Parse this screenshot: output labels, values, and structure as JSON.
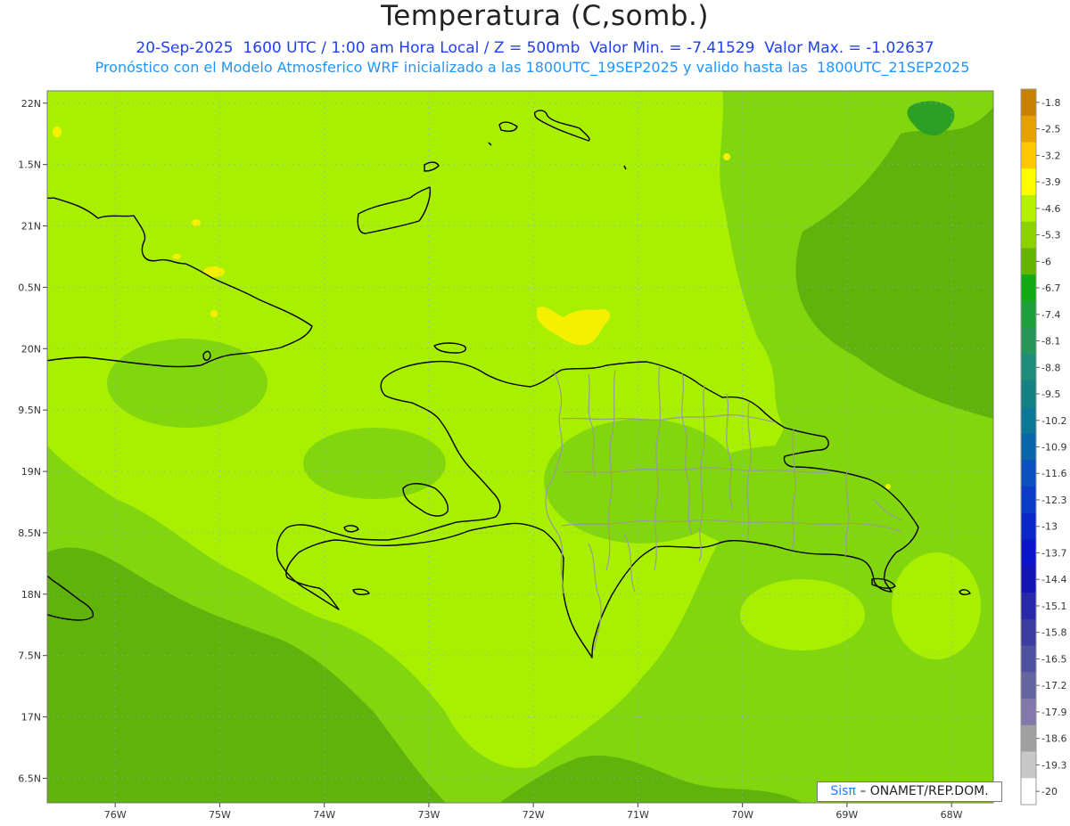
{
  "title": "Temperatura (C,somb.)",
  "subtitle_line1": "20-Sep-2025  1600 UTC / 1:00 am Hora Local / Z = 500mb  Valor Min. = -7.41529  Valor Max. = -1.02637",
  "subtitle_line2": "Pronóstico con el Modelo Atmosferico WRF inicializado a las 1800UTC_19SEP2025 y valido hasta las  1800UTC_21SEP2025",
  "credit": {
    "sis": "Sisπ",
    "org": "– ONAMET/REP.DOM."
  },
  "map": {
    "lon_range": [
      -76.65,
      -67.6
    ],
    "lat_range": [
      16.3,
      22.1
    ],
    "lat_ticks": [
      {
        "value": 22.0,
        "label": "22N"
      },
      {
        "value": 21.5,
        "label": "1.5N"
      },
      {
        "value": 21.0,
        "label": "21N"
      },
      {
        "value": 20.5,
        "label": "0.5N"
      },
      {
        "value": 20.0,
        "label": "20N"
      },
      {
        "value": 19.5,
        "label": "9.5N"
      },
      {
        "value": 19.0,
        "label": "19N"
      },
      {
        "value": 18.5,
        "label": "8.5N"
      },
      {
        "value": 18.0,
        "label": "18N"
      },
      {
        "value": 17.5,
        "label": "7.5N"
      },
      {
        "value": 17.0,
        "label": "17N"
      },
      {
        "value": 16.5,
        "label": "6.5N"
      }
    ],
    "lon_ticks": [
      {
        "value": -76,
        "label": "76W"
      },
      {
        "value": -75,
        "label": "75W"
      },
      {
        "value": -74,
        "label": "74W"
      },
      {
        "value": -73,
        "label": "73W"
      },
      {
        "value": -72,
        "label": "72W"
      },
      {
        "value": -71,
        "label": "71W"
      },
      {
        "value": -70,
        "label": "70W"
      },
      {
        "value": -69,
        "label": "69W"
      },
      {
        "value": -68,
        "label": "68W"
      }
    ],
    "colors": {
      "base": "#82d60e",
      "light": "#a8f000",
      "dark": "#5fb30b",
      "darkest": "#2ba024",
      "yellow": "#f5f000",
      "coast": "#000000",
      "provinces": "#9a9a9a",
      "grid": "#a0a0d0"
    }
  },
  "legend": {
    "labels": [
      "-1.8",
      "-2.5",
      "-3.2",
      "-3.9",
      "-4.6",
      "-5.3",
      "-6",
      "-6.7",
      "-7.4",
      "-8.1",
      "-8.8",
      "-9.5",
      "-10.2",
      "-10.9",
      "-11.6",
      "-12.3",
      "-13",
      "-13.7",
      "-14.4",
      "-15.1",
      "-15.8",
      "-16.5",
      "-17.2",
      "-17.9",
      "-18.6",
      "-19.3",
      "-20"
    ],
    "colors": [
      "#c88000",
      "#e6a000",
      "#ffc800",
      "#ffff00",
      "#b4f000",
      "#8cd200",
      "#64b400",
      "#14aa14",
      "#1ea03c",
      "#28965a",
      "#1e8c78",
      "#148282",
      "#0a7896",
      "#0a64aa",
      "#0a50be",
      "#0a3cc8",
      "#0a28c8",
      "#0a14c8",
      "#1414b4",
      "#2828aa",
      "#3c3ca0",
      "#5050a0",
      "#6464a0",
      "#8278aa",
      "#a0a0a0",
      "#c8c8c8",
      "#ffffff"
    ]
  }
}
